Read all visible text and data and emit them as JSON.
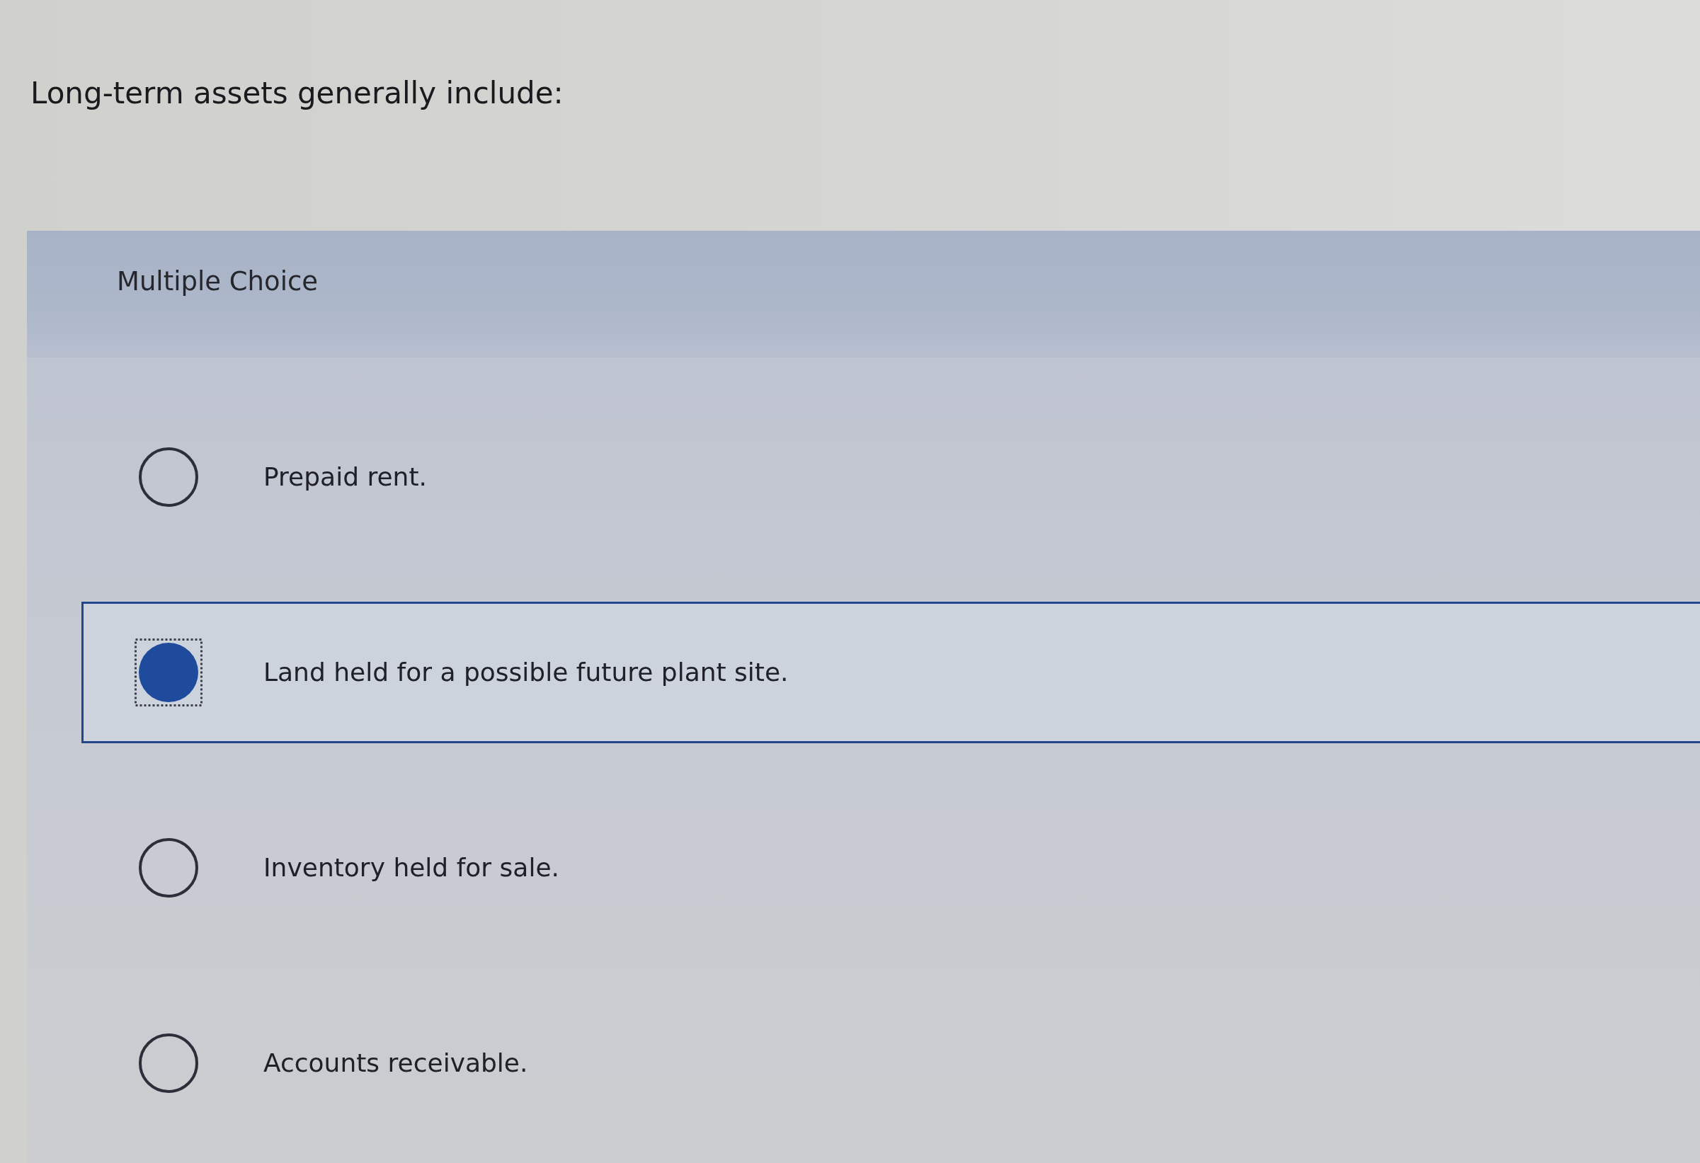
{
  "question": {
    "text": "Long-term assets generally include:"
  },
  "panel": {
    "title": "Multiple Choice"
  },
  "options": [
    {
      "label": "Prepaid rent.",
      "selected": false,
      "focused": false
    },
    {
      "label": "Land held for a possible future plant site.",
      "selected": true,
      "focused": true
    },
    {
      "label": "Inventory held for sale.",
      "selected": false,
      "focused": false
    },
    {
      "label": "Accounts receivable.",
      "selected": false,
      "focused": false
    }
  ]
}
